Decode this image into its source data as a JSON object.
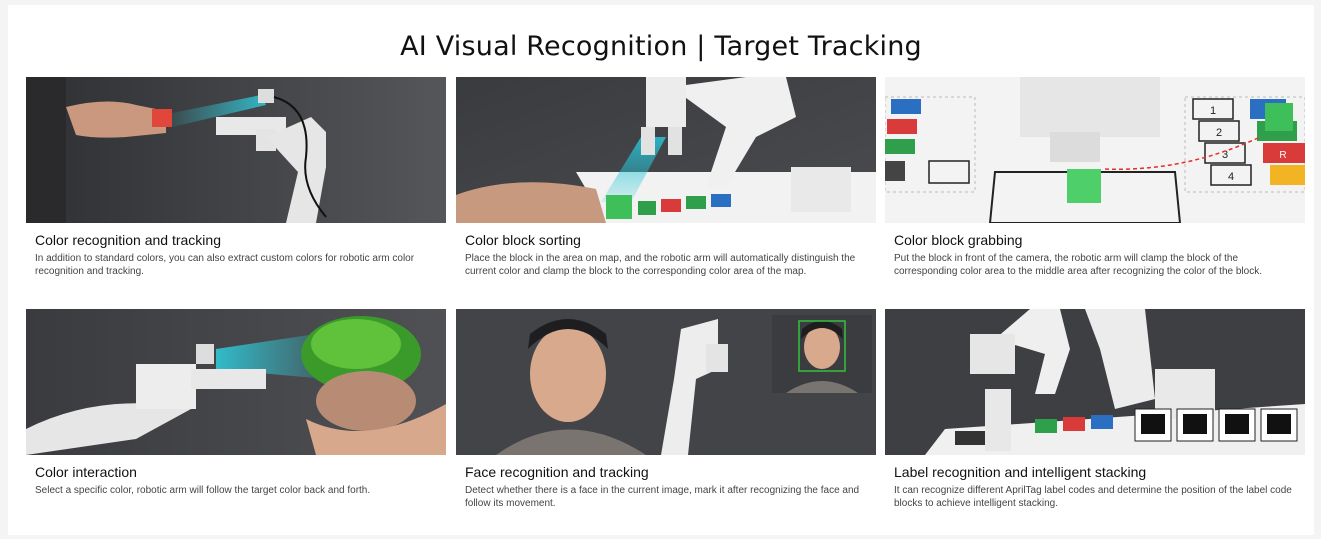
{
  "title": "AI Visual Recognition | Target Tracking",
  "cards": [
    {
      "title": "Color recognition and tracking",
      "desc": "In addition to standard colors, you can also extract custom colors for robotic arm color recognition and tracking."
    },
    {
      "title": "Color block sorting",
      "desc": "Place the block in the area on map, and the robotic arm will automatically distinguish the current color and clamp the block to the corresponding color area of the map."
    },
    {
      "title": "Color block grabbing",
      "desc": "Put the block in front of the camera, the robotic arm will clamp the block of the corresponding color area to the middle area after recognizing the color of the block."
    },
    {
      "title": "Color interaction",
      "desc": "Select a specific color, robotic arm will follow the target color back and forth."
    },
    {
      "title": "Face recognition and tracking",
      "desc": "Detect whether there is a face in the current image, mark it after recognizing the face and follow its movement."
    },
    {
      "title": "Label recognition and intelligent stacking",
      "desc": "It can recognize different AprilTag label codes and determine the position of the label code blocks to achieve intelligent stacking."
    }
  ],
  "grab_map_labels": [
    "1",
    "2",
    "3",
    "4",
    "R"
  ]
}
